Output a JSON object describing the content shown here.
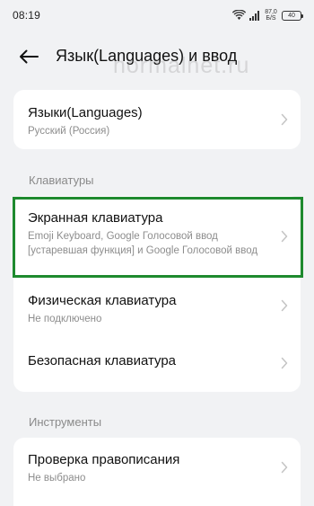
{
  "status_bar": {
    "time": "08:19",
    "net_speed_value": "87,0",
    "net_speed_unit": "Б/S",
    "battery": "40",
    "icons": [
      "wifi-icon",
      "signal-icon",
      "battery-icon"
    ]
  },
  "header": {
    "title": "Язык(Languages) и ввод",
    "back_icon": "arrow-left-icon"
  },
  "watermark": "normalnet.ru",
  "languages_card": {
    "title": "Языки(Languages)",
    "subtitle": "Русский (Россия)"
  },
  "keyboards_section": {
    "label": "Клавиатуры",
    "items": [
      {
        "title": "Экранная клавиатура",
        "subtitle": "Emoji Keyboard, Google Голосовой ввод [устаревшая функция] и Google Голосовой ввод"
      },
      {
        "title": "Физическая клавиатура",
        "subtitle": "Не подключено"
      },
      {
        "title": "Безопасная клавиатура",
        "subtitle": ""
      }
    ]
  },
  "tools_section": {
    "label": "Инструменты",
    "items": [
      {
        "title": "Проверка правописания",
        "subtitle": "Не выбрано"
      }
    ]
  },
  "colors": {
    "background": "#f1f2f4",
    "card": "#ffffff",
    "highlight": "#1e8a2e",
    "secondary_text": "#8d8d8d"
  }
}
